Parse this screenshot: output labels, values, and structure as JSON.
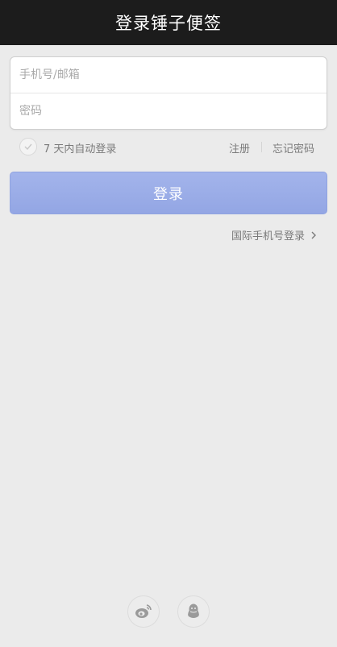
{
  "header": {
    "title": "登录锤子便签"
  },
  "form": {
    "phone_placeholder": "手机号/邮箱",
    "password_placeholder": "密码"
  },
  "options": {
    "remember_label": "7 天内自动登录",
    "register_label": "注册",
    "forgot_label": "忘记密码",
    "remember_checked": false
  },
  "login_button": {
    "label": "登录"
  },
  "intl_login": {
    "label": "国际手机号登录"
  },
  "social": {
    "icons": [
      "weibo-icon",
      "qq-icon"
    ]
  },
  "colors": {
    "header_bg": "#1c1c1c",
    "page_bg": "#ebebeb",
    "login_button": "#9aace7",
    "muted_text": "#7a7a7a"
  }
}
